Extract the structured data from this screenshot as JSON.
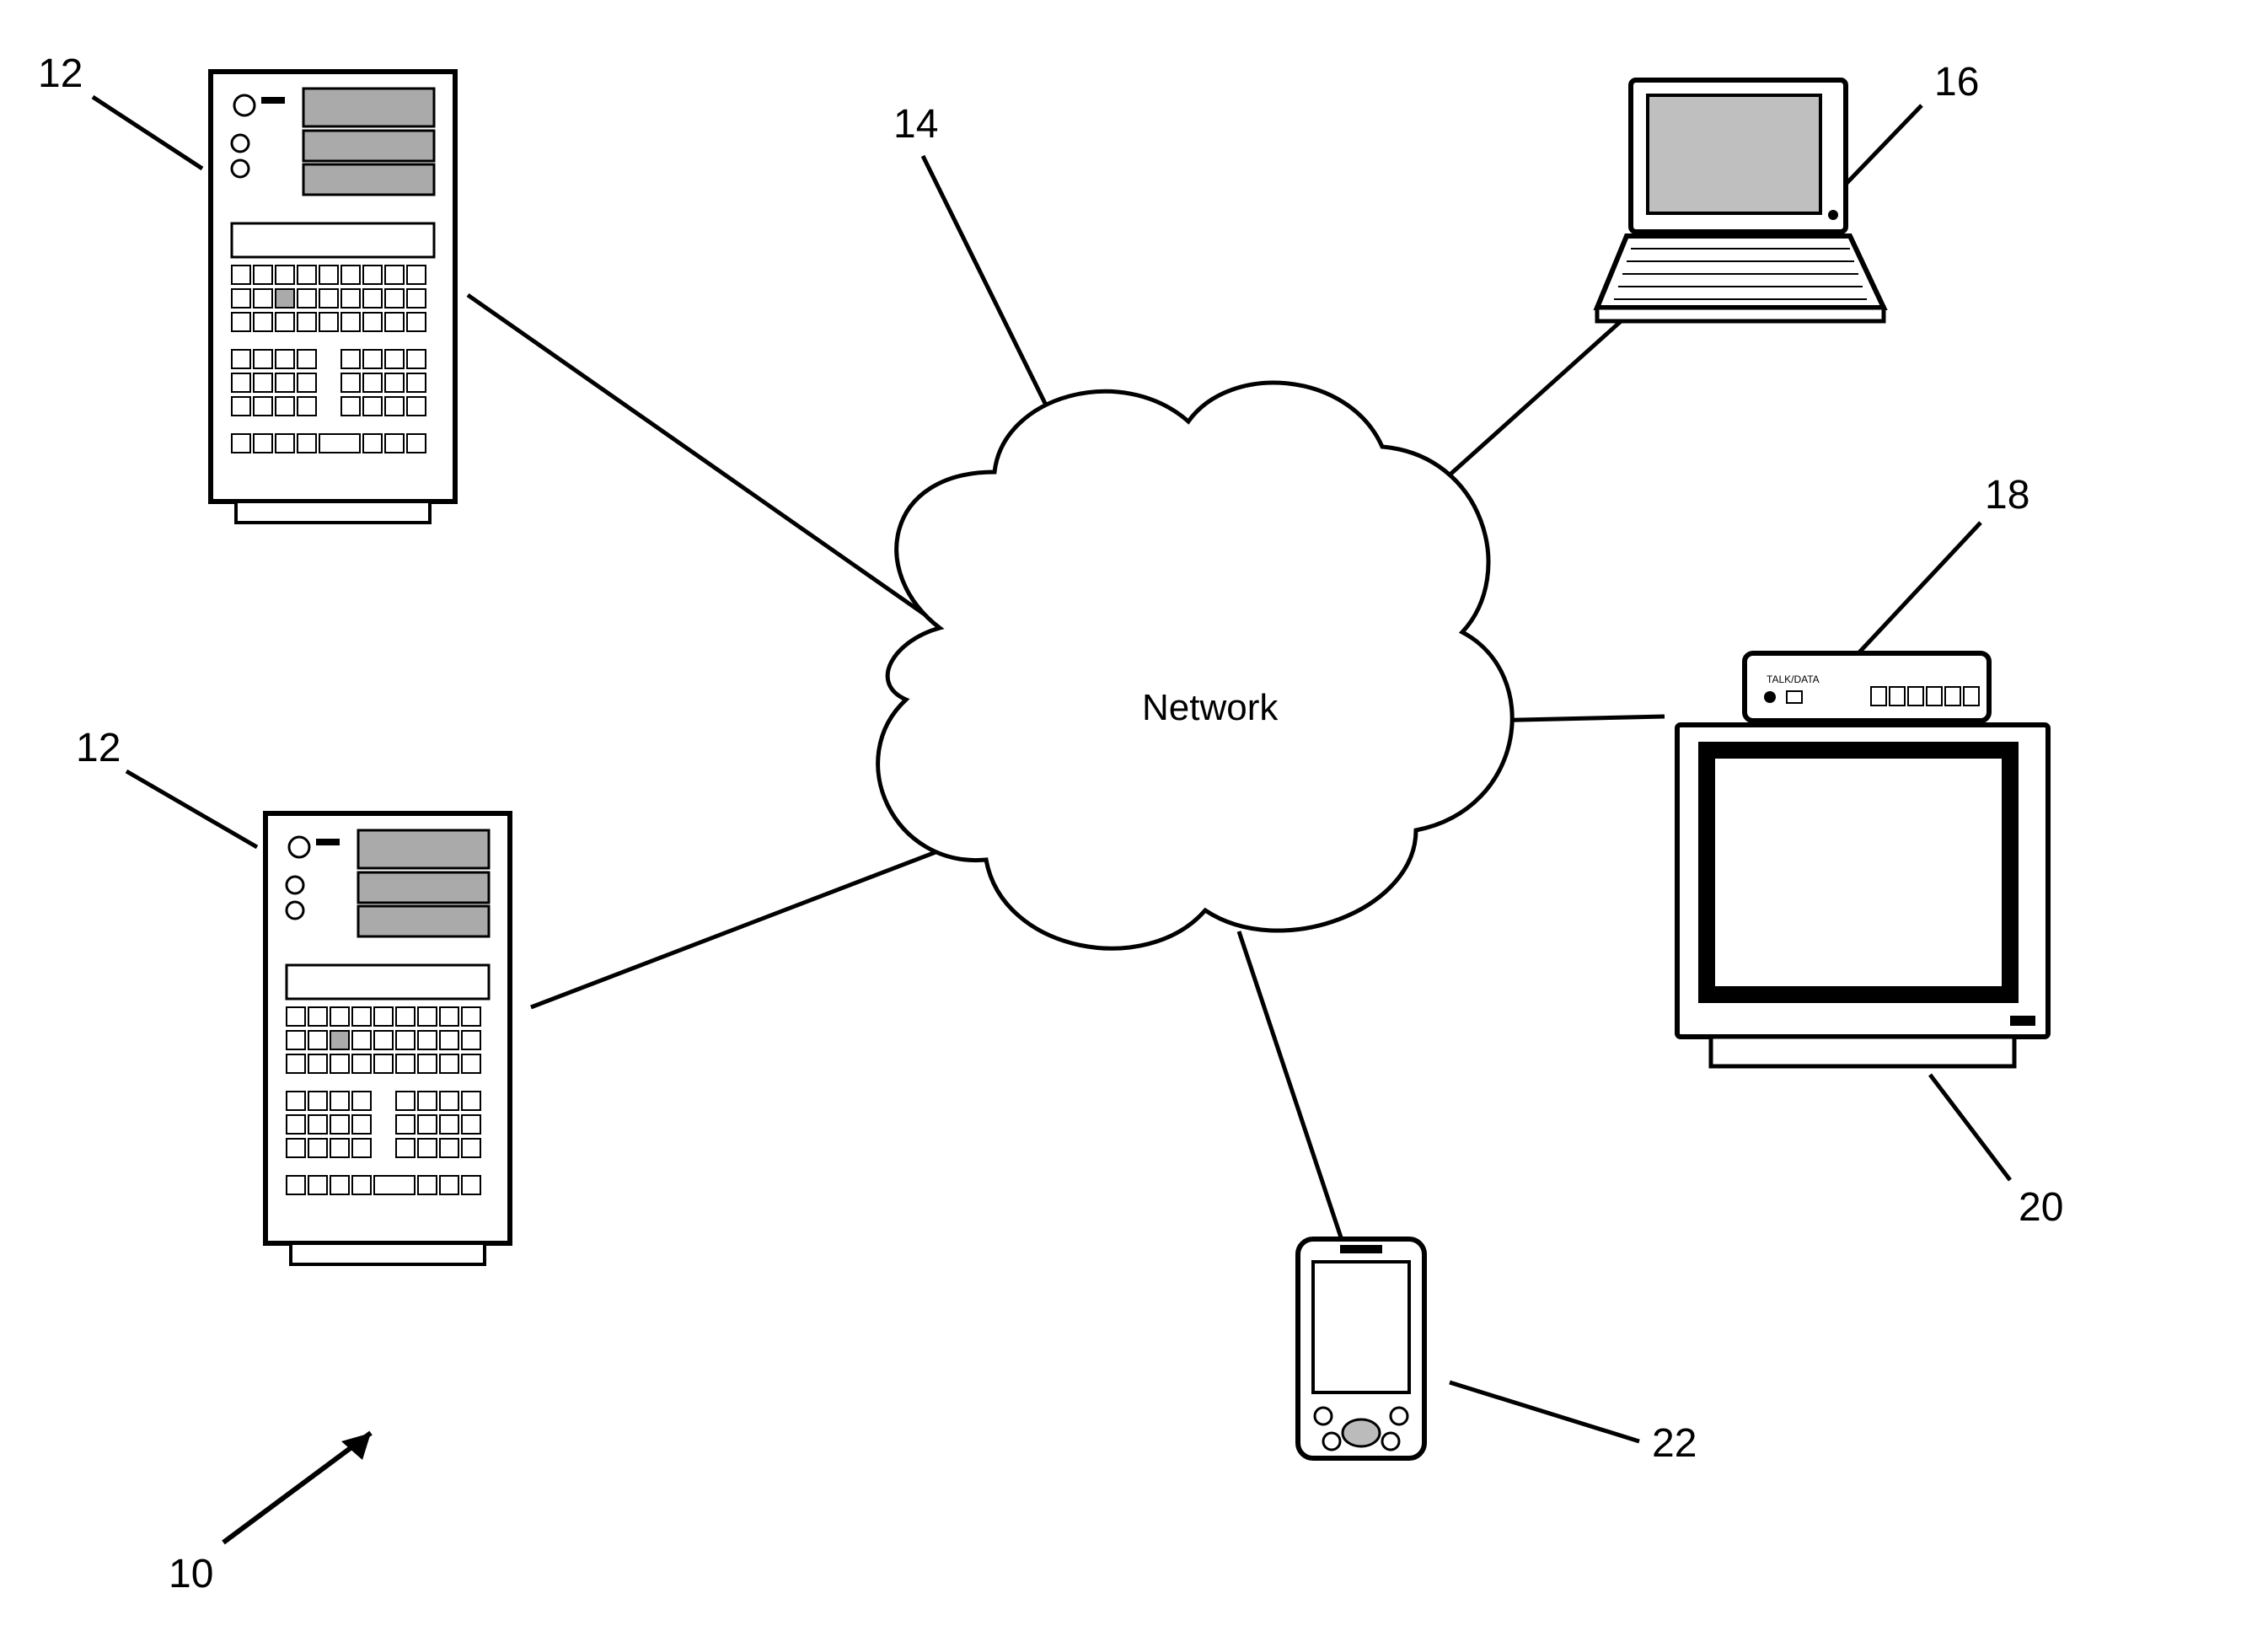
{
  "labels": {
    "ref_12a": "12",
    "ref_12b": "12",
    "ref_14": "14",
    "ref_16": "16",
    "ref_18": "18",
    "ref_20": "20",
    "ref_22": "22",
    "ref_10": "10"
  },
  "network_label": "Network"
}
